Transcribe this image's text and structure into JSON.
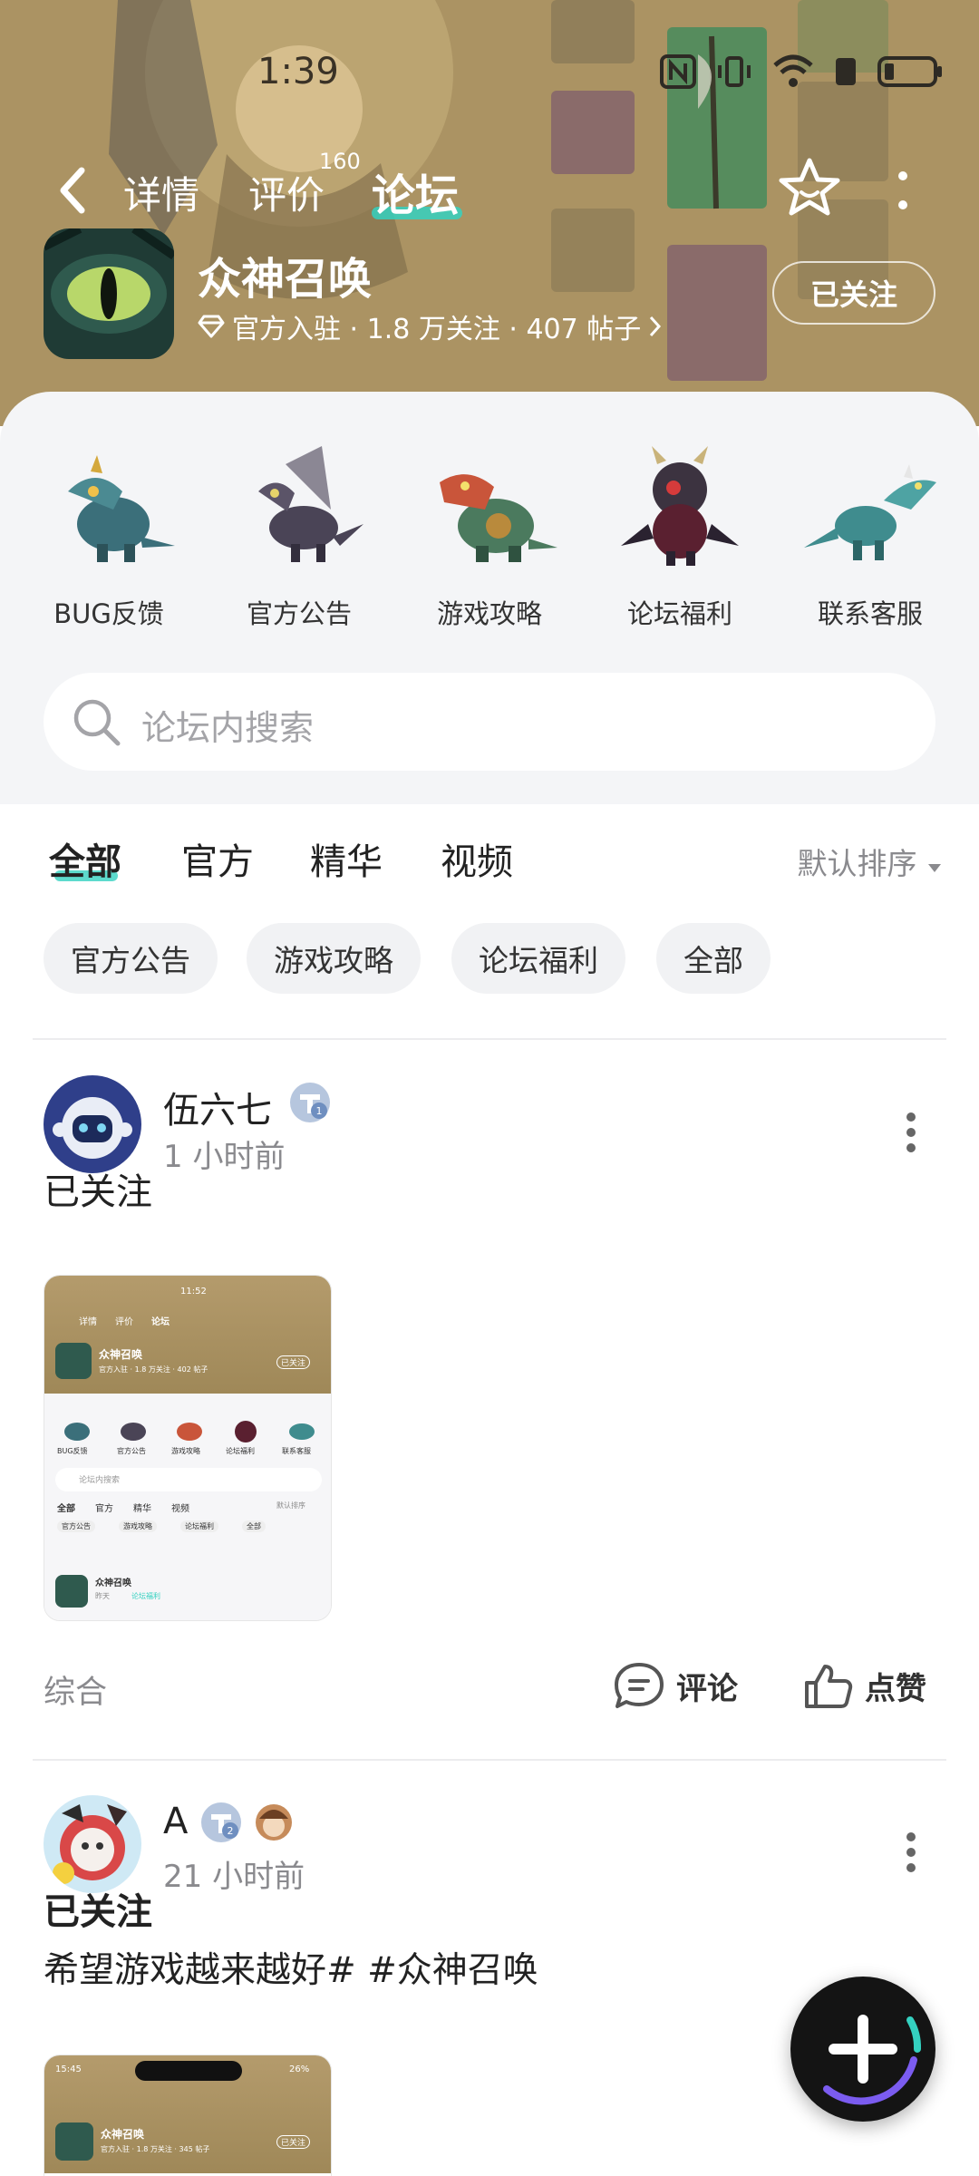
{
  "status_bar": {
    "time": "1:39",
    "icons": [
      "nfc-icon",
      "vibrate-icon",
      "wifi-icon",
      "sim-icon",
      "battery-icon"
    ]
  },
  "nav": {
    "tabs": [
      {
        "label": "详情"
      },
      {
        "label": "评价",
        "badge": "160"
      },
      {
        "label": "论坛",
        "active": true
      }
    ],
    "accent": "#34d1c0"
  },
  "app": {
    "name": "众神召唤",
    "meta": "官方入驻 · 1.8 万关注 · 407 帖子",
    "follow_label": "已关注"
  },
  "quick_links": [
    {
      "label": "BUG反馈"
    },
    {
      "label": "官方公告"
    },
    {
      "label": "游戏攻略"
    },
    {
      "label": "论坛福利"
    },
    {
      "label": "联系客服"
    }
  ],
  "search": {
    "placeholder": "论坛内搜索"
  },
  "filter_tabs": [
    {
      "label": "全部",
      "active": true
    },
    {
      "label": "官方"
    },
    {
      "label": "精华"
    },
    {
      "label": "视频"
    }
  ],
  "sort_label": "默认排序",
  "chips": [
    {
      "label": "官方公告"
    },
    {
      "label": "游戏攻略"
    },
    {
      "label": "论坛福利"
    },
    {
      "label": "全部"
    }
  ],
  "posts": [
    {
      "author": "伍六七",
      "level": "1",
      "time": "1 小时前",
      "title": "已关注",
      "thumbnail": {
        "time": "11:52",
        "tabs": [
          "详情",
          "评价",
          "论坛"
        ],
        "app_name": "众神召唤",
        "app_meta": "官方入驻 · 1.8 万关注 · 402 帖子",
        "follow": "已关注",
        "quick": [
          "BUG反馈",
          "官方公告",
          "游戏攻略",
          "论坛福利",
          "联系客服"
        ],
        "search": "论坛内搜索",
        "filter": [
          "全部",
          "官方",
          "精华",
          "视频"
        ],
        "sort": "默认排序",
        "chips": [
          "官方公告",
          "游戏攻略",
          "论坛福利",
          "全部"
        ],
        "post_name": "众神召唤",
        "post_meta": "昨天",
        "post_tag": "论坛福利"
      },
      "category": "综合",
      "comment_label": "评论",
      "like_label": "点赞"
    },
    {
      "author": "A",
      "level": "2",
      "time": "21 小时前",
      "title": "已关注",
      "body": "希望游戏越来越好# #众神召唤",
      "thumbnail": {
        "time": "15:45",
        "battery": "26%",
        "app_name": "众神召唤",
        "app_meta": "官方入驻 · 1.8 万关注 · 345 帖子",
        "follow": "已关注"
      }
    }
  ],
  "fab_icon": "plus-icon"
}
